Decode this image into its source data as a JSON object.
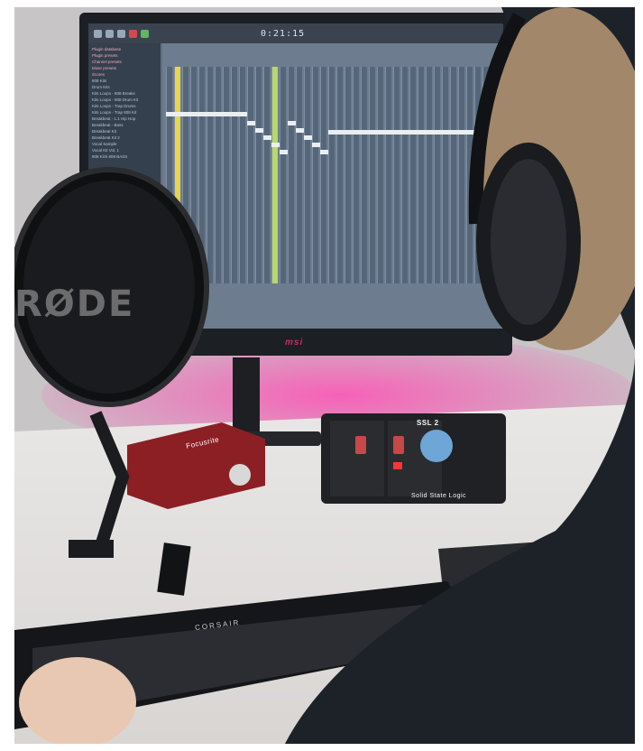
{
  "scene": {
    "description_label": "Home studio setup",
    "monitor_brand": "msi",
    "microphone_brand": "RØDE",
    "audio_interface_1": "Focusrite",
    "audio_interface_2_top": "SSL 2",
    "audio_interface_2_bottom": "Solid State Logic",
    "keyboard_brand": "CORSAIR"
  },
  "daw": {
    "time_display": "0:21:15",
    "browser_items": [
      "Plugin database",
      "Plugin presets",
      "Channel presets",
      "Mixer presets",
      "Scores",
      "808 Kits",
      "Drum Kits",
      "Kits Loops - 808 Breaks",
      "Kits Loops - 808 Drum Kit",
      "Kits Loops - Trap Drums",
      "Kits Loops - Trap 808 Kit",
      "Breakbeat - 1.1 Hip Hop",
      "Breakbeat - Bass",
      "Breakbeat Kit",
      "Breakbeat Kit 2",
      "Vocal Sample",
      "Vocal Kit Vol. 1",
      "808 Kick 808 BASS"
    ],
    "highlighted_items": [
      0,
      1,
      2,
      3,
      4
    ]
  },
  "colors": {
    "accent_pink": "#e04e9a",
    "screen_bg": "#5f6e80",
    "green_channel": "#b9d86a",
    "yellow_channel": "#e6d64a"
  }
}
